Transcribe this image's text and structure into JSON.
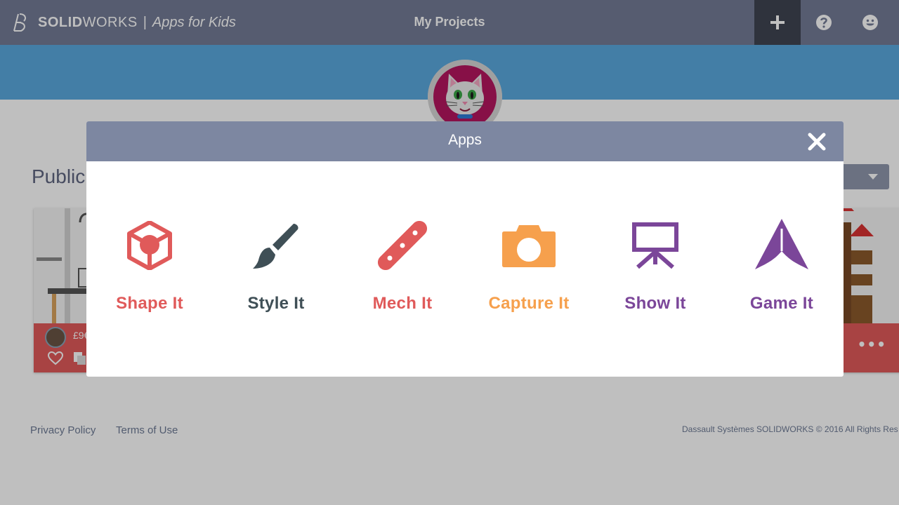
{
  "header": {
    "brand_main": "SOLID",
    "brand_rest": "WORKS",
    "brand_separator": "|",
    "brand_sub": "Apps for Kids",
    "page_title": "My Projects",
    "icons": [
      "plus-icon",
      "help-icon",
      "smiley-icon"
    ]
  },
  "content": {
    "section_title": "Public",
    "card_author": "£9€",
    "card_more": "•••"
  },
  "footer": {
    "privacy": "Privacy Policy",
    "terms": "Terms of Use",
    "copyright": "Dassault Systèmes SOLIDWORKS © 2016 All Rights Res"
  },
  "modal": {
    "title": "Apps",
    "apps": [
      {
        "label": "Shape It",
        "icon": "cube-icon",
        "color": "#e05a5a"
      },
      {
        "label": "Style It",
        "icon": "paintbrush-icon",
        "color": "#3f4f56"
      },
      {
        "label": "Mech It",
        "icon": "link-bar-icon",
        "color": "#e05a5a"
      },
      {
        "label": "Capture It",
        "icon": "camera-icon",
        "color": "#f6a04d"
      },
      {
        "label": "Show It",
        "icon": "presentation-board-icon",
        "color": "#7b4699"
      },
      {
        "label": "Game It",
        "icon": "arrow-nav-icon",
        "color": "#7b4699"
      }
    ]
  },
  "colors": {
    "header_bg": "#737b96",
    "banner_bg": "#5aa9de",
    "modal_header_bg": "#7d87a1",
    "card_footer": "#e05a5a"
  }
}
